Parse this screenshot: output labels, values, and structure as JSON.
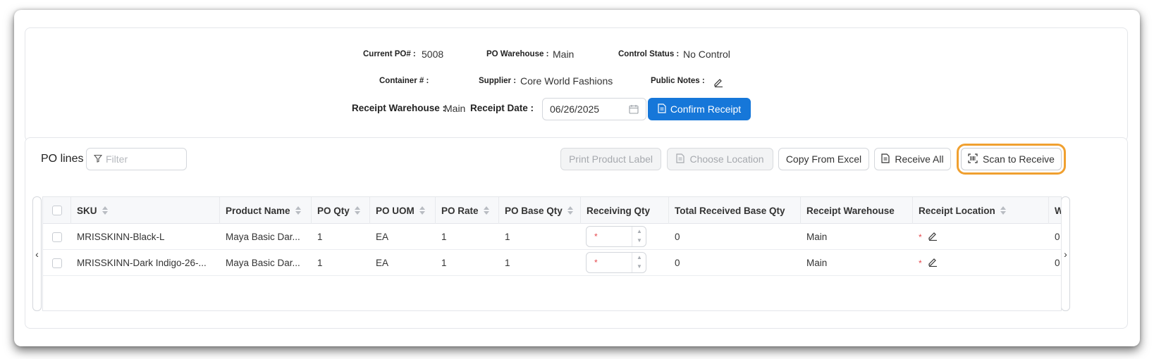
{
  "header": {
    "current_po_label": "Current PO# :",
    "current_po_value": "5008",
    "po_warehouse_label": "PO Warehouse :",
    "po_warehouse_value": "Main",
    "control_status_label": "Control Status :",
    "control_status_value": "No Control",
    "container_label": "Container # :",
    "container_value": "",
    "supplier_label": "Supplier :",
    "supplier_value": "Core World Fashions",
    "public_notes_label": "Public Notes :",
    "receipt_warehouse_label": "Receipt Warehouse :",
    "receipt_warehouse_value": "Main",
    "receipt_date_label": "Receipt Date :",
    "receipt_date_value": "06/26/2025",
    "confirm_receipt_label": "Confirm Receipt"
  },
  "lines": {
    "title": "PO lines",
    "filter_placeholder": "Filter",
    "toolbar": {
      "print_product_label": "Print Product Label",
      "choose_location": "Choose Location",
      "copy_from_excel": "Copy From Excel",
      "receive_all": "Receive All",
      "scan_to_receive": "Scan to Receive"
    },
    "columns": [
      "SKU",
      "Product Name",
      "PO Qty",
      "PO UOM",
      "PO Rate",
      "PO Base Qty",
      "Receiving Qty",
      "Total Received Base Qty",
      "Receipt Warehouse",
      "Receipt Location",
      "W"
    ],
    "rows": [
      {
        "sku": "MRISSKINN-Black-L",
        "product_name": "Maya Basic Dar...",
        "po_qty": "1",
        "po_uom": "EA",
        "po_rate": "1",
        "po_base_qty": "1",
        "receiving_qty": "*",
        "total_received_base_qty": "0",
        "receipt_warehouse": "Main",
        "receipt_location": "*",
        "w": "0"
      },
      {
        "sku": "MRISSKINN-Dark Indigo-26-...",
        "product_name": "Maya Basic Dar...",
        "po_qty": "1",
        "po_uom": "EA",
        "po_rate": "1",
        "po_base_qty": "1",
        "receiving_qty": "*",
        "total_received_base_qty": "0",
        "receipt_warehouse": "Main",
        "receipt_location": "*",
        "w": "0"
      }
    ],
    "scroll_left": "‹",
    "scroll_right": "›"
  },
  "colors": {
    "primary": "#1677d9",
    "highlight": "#f0a030",
    "required": "#e5484d"
  },
  "icons": [
    "edit-icon",
    "calendar-icon",
    "document-icon",
    "filter-icon",
    "barcode-scan-icon",
    "sort-icon"
  ]
}
